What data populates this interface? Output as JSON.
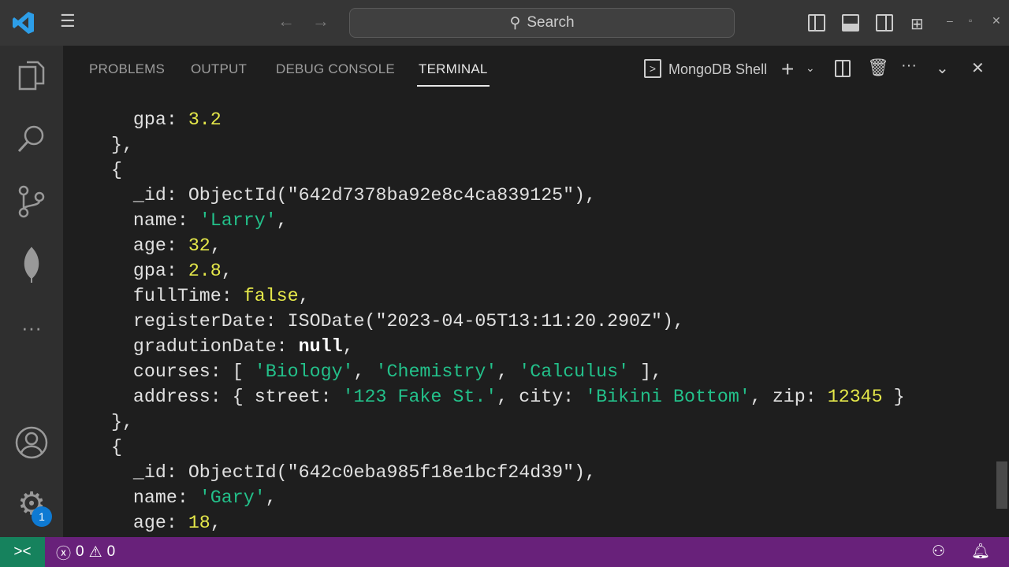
{
  "titlebar": {
    "search_placeholder": "Search"
  },
  "panel": {
    "tabs": [
      "PROBLEMS",
      "OUTPUT",
      "DEBUG CONSOLE",
      "TERMINAL"
    ],
    "active_tab": "TERMINAL",
    "terminal_name": "MongoDB Shell"
  },
  "activity": {
    "settings_badge": "1"
  },
  "status": {
    "errors": "0",
    "warnings": "0"
  },
  "terminal_lines": [
    [
      [
        "    gpa: ",
        "k"
      ],
      [
        "3.2",
        "n"
      ]
    ],
    [
      [
        "  },",
        "k"
      ]
    ],
    [
      [
        "  {",
        "k"
      ]
    ],
    [
      [
        "    _id: ObjectId(\"642d7378ba92e8c4ca839125\"),",
        "k"
      ]
    ],
    [
      [
        "    name: ",
        "k"
      ],
      [
        "'Larry'",
        "s"
      ],
      [
        ",",
        "k"
      ]
    ],
    [
      [
        "    age: ",
        "k"
      ],
      [
        "32",
        "n"
      ],
      [
        ",",
        "k"
      ]
    ],
    [
      [
        "    gpa: ",
        "k"
      ],
      [
        "2.8",
        "n"
      ],
      [
        ",",
        "k"
      ]
    ],
    [
      [
        "    fullTime: ",
        "k"
      ],
      [
        "false",
        "b"
      ],
      [
        ",",
        "k"
      ]
    ],
    [
      [
        "    registerDate: ISODate(\"2023-04-05T13:11:20.290Z\"),",
        "k"
      ]
    ],
    [
      [
        "    gradutionDate: ",
        "k"
      ],
      [
        "null",
        "nl"
      ],
      [
        ",",
        "k"
      ]
    ],
    [
      [
        "    courses: [ ",
        "k"
      ],
      [
        "'Biology'",
        "s"
      ],
      [
        ", ",
        "k"
      ],
      [
        "'Chemistry'",
        "s"
      ],
      [
        ", ",
        "k"
      ],
      [
        "'Calculus'",
        "s"
      ],
      [
        " ],",
        "k"
      ]
    ],
    [
      [
        "    address: { street: ",
        "k"
      ],
      [
        "'123 Fake St.'",
        "s"
      ],
      [
        ", city: ",
        "k"
      ],
      [
        "'Bikini Bottom'",
        "s"
      ],
      [
        ", zip: ",
        "k"
      ],
      [
        "12345",
        "n"
      ],
      [
        " }",
        "k"
      ]
    ],
    [
      [
        "  },",
        "k"
      ]
    ],
    [
      [
        "  {",
        "k"
      ]
    ],
    [
      [
        "    _id: ObjectId(\"642c0eba985f18e1bcf24d39\"),",
        "k"
      ]
    ],
    [
      [
        "    name: ",
        "k"
      ],
      [
        "'Gary'",
        "s"
      ],
      [
        ",",
        "k"
      ]
    ],
    [
      [
        "    age: ",
        "k"
      ],
      [
        "18",
        "n"
      ],
      [
        ",",
        "k"
      ]
    ]
  ]
}
